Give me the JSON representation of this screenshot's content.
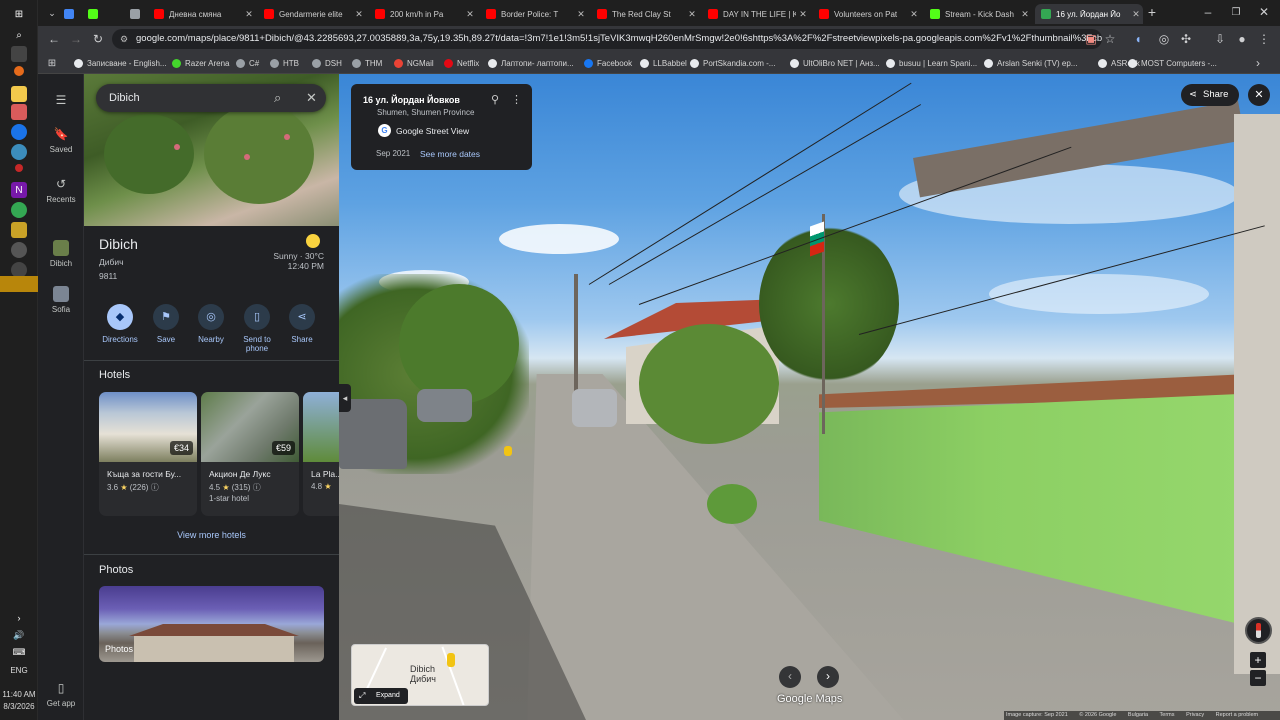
{
  "taskbar": {
    "language": "ENG",
    "time": "11:40 AM",
    "date": "8/3/2026"
  },
  "tabs": [
    {
      "label": "",
      "favicon": "google-icon",
      "color": "#4285f4"
    },
    {
      "label": "",
      "favicon": "kick-icon",
      "color": "#53fc18"
    },
    {
      "label": "",
      "favicon": "page-icon",
      "color": "#9aa0a6"
    },
    {
      "label": "Дневна смяна",
      "favicon": "youtube-icon",
      "color": "#ff0000"
    },
    {
      "label": "Gendarmerie elite",
      "favicon": "youtube-icon",
      "color": "#ff0000"
    },
    {
      "label": "200 km/h in Pa",
      "favicon": "youtube-icon",
      "color": "#ff0000"
    },
    {
      "label": "Border Police: T",
      "favicon": "youtube-icon",
      "color": "#ff0000"
    },
    {
      "label": "The Red Clay St",
      "favicon": "youtube-icon",
      "color": "#ff0000"
    },
    {
      "label": "DAY IN THE LIFE | K",
      "favicon": "youtube-icon",
      "color": "#ff0000"
    },
    {
      "label": "Volunteers on Pat",
      "favicon": "youtube-icon",
      "color": "#ff0000"
    },
    {
      "label": "Stream - Kick Dash",
      "favicon": "kick-icon",
      "color": "#53fc18"
    },
    {
      "label": "16 ул. Йордан Йо",
      "favicon": "maps-icon",
      "color": "#34a853",
      "active": true
    }
  ],
  "address": {
    "url": "google.com/maps/place/9811+Dibich/@43.2285693,27.0035889,3a,75y,19.35h,89.27t/data=!3m7!1e1!3m5!1sjTeVIK3mwqH260enMrSmgw!2e0!6shttps%3A%2F%2Fstreetviewpixels-pa.googleapis.com%2Fv1%2Fthumbnail%3Fcb_client%3Dmaps_sv..."
  },
  "bookmarks": [
    {
      "label": "Записване - English...",
      "color": "#e8eaed"
    },
    {
      "label": "Razer Arena",
      "color": "#44d62c"
    },
    {
      "label": "C#",
      "color": "#9aa0a6"
    },
    {
      "label": "НТВ",
      "color": "#9aa0a6"
    },
    {
      "label": "DSH",
      "color": "#9aa0a6"
    },
    {
      "label": "THM",
      "color": "#9aa0a6"
    },
    {
      "label": "NGMail",
      "color": "#ea4335"
    },
    {
      "label": "Netflix",
      "color": "#e50914"
    },
    {
      "label": "Лаптопи- лаптопи...",
      "color": "#e8eaed"
    },
    {
      "label": "Facebook",
      "color": "#1877f2"
    },
    {
      "label": "LLBabbel",
      "color": "#e8eaed"
    },
    {
      "label": "PortSkandia.com -...",
      "color": "#e8eaed"
    },
    {
      "label": "UltOliBro NET | Анз...",
      "color": "#e8eaed"
    },
    {
      "label": "busuu | Learn Spani...",
      "color": "#e8eaed"
    },
    {
      "label": "Arslan Senki (TV) ep...",
      "color": "#e8eaed"
    },
    {
      "label": "ASRock",
      "color": "#e8eaed"
    },
    {
      "label": "MOST Computers -...",
      "color": "#e8eaed"
    }
  ],
  "rail": {
    "saved": "Saved",
    "recents": "Recents",
    "place1": "Dibich",
    "place2": "Sofia",
    "get_app": "Get app"
  },
  "panel": {
    "search_value": "Dibich",
    "title": "Dibich",
    "subtitle": "Дибич",
    "postcode": "9811",
    "weather": "Sunny · 30°C",
    "weather_time": "12:40 PM",
    "actions": [
      "Directions",
      "Save",
      "Nearby",
      "Send to phone",
      "Share"
    ],
    "hotels_title": "Hotels",
    "hotels": [
      {
        "name": "Къща за гости Бу...",
        "rating": "3.6",
        "reviews": "(226)",
        "price": "€34",
        "type": ""
      },
      {
        "name": "Акцион Де Лукс",
        "rating": "4.5",
        "reviews": "(315)",
        "price": "€59",
        "type": "1-star hotel"
      },
      {
        "name": "La Pla...",
        "rating": "4.8",
        "reviews": "",
        "price": "",
        "type": ""
      }
    ],
    "view_more": "View more hotels",
    "photos_title": "Photos",
    "photos_label": "Photos"
  },
  "streetview": {
    "address": "16 ул. Йордан Йовков",
    "region": "Shumen, Shumen Province",
    "source": "Google Street View",
    "date": "Sep 2021",
    "see_more": "See more dates",
    "share": "Share",
    "minimap_title": "Dibich",
    "minimap_sub": "Дибич",
    "expand": "Expand",
    "logo": "Google Maps",
    "footer": [
      "Image capture: Sep 2021",
      "© 2026 Google",
      "Bulgaria",
      "Terms",
      "Privacy",
      "Report a problem"
    ]
  }
}
